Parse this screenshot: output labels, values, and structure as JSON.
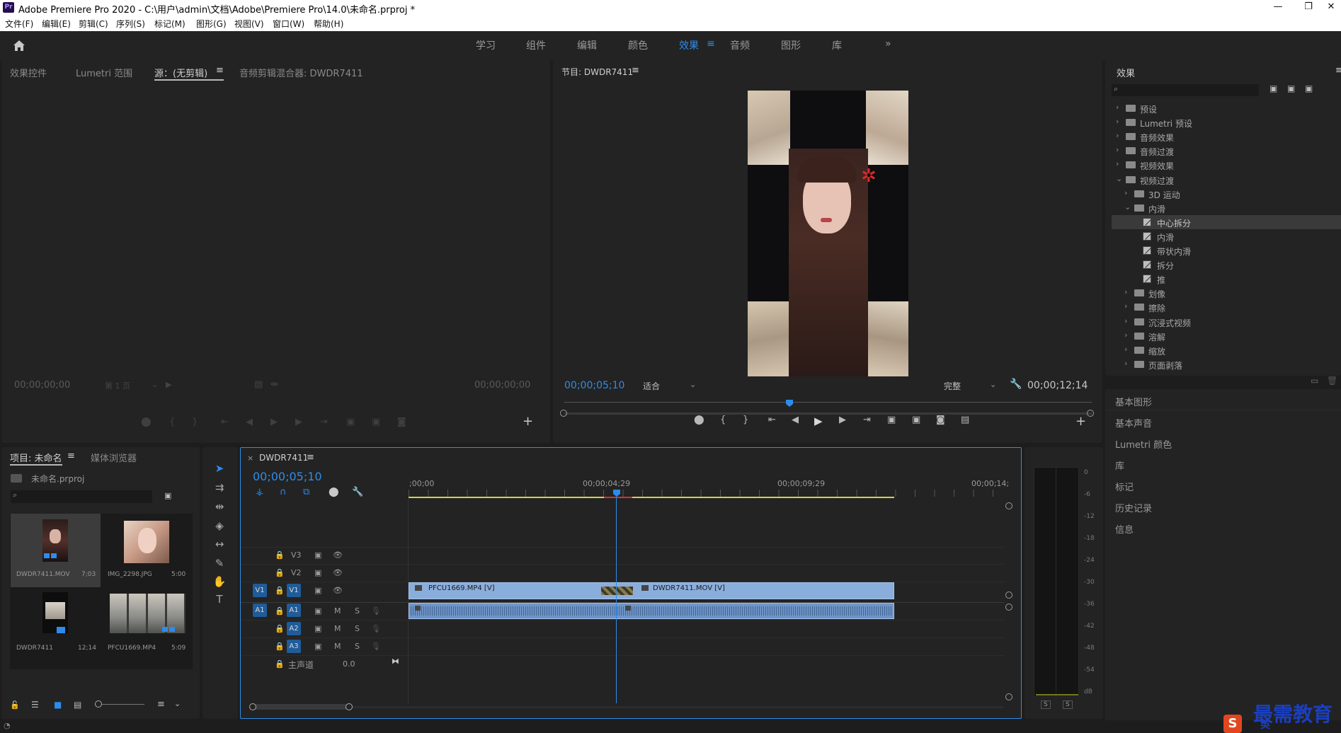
{
  "titlebar": {
    "app_icon": "Pr",
    "title": "Adobe Premiere Pro 2020 - C:\\用户\\admin\\文档\\Adobe\\Premiere Pro\\14.0\\未命名.prproj *",
    "minimize": "—",
    "maximize": "❐",
    "close": "✕"
  },
  "menu": [
    "文件(F)",
    "编辑(E)",
    "剪辑(C)",
    "序列(S)",
    "标记(M)",
    "图形(G)",
    "视图(V)",
    "窗口(W)",
    "帮助(H)"
  ],
  "workspaces": {
    "items": [
      "学习",
      "组件",
      "编辑",
      "颜色",
      "效果",
      "音频",
      "图形",
      "库"
    ],
    "active": "效果",
    "more": "»"
  },
  "source_panel": {
    "tabs": [
      "效果控件",
      "Lumetri 范围",
      "源：(无剪辑)",
      "音频剪辑混合器: DWDR7411"
    ],
    "active_tab": "源：(无剪辑)",
    "timecode_left": "00;00;00;00",
    "page": "第 1 页",
    "timecode_right": "00;00;00;00",
    "add": "+"
  },
  "program_panel": {
    "title": "节目: DWDR7411",
    "timecode": "00;00;05;10",
    "fit": "适合",
    "quality": "完整",
    "duration": "00;00;12;14",
    "add": "+"
  },
  "effects_panel": {
    "title": "效果",
    "tree": [
      {
        "label": "预设",
        "level": 0,
        "type": "folder",
        "expanded": false
      },
      {
        "label": "Lumetri 预设",
        "level": 0,
        "type": "folder",
        "expanded": false
      },
      {
        "label": "音频效果",
        "level": 0,
        "type": "folder",
        "expanded": false
      },
      {
        "label": "音频过渡",
        "level": 0,
        "type": "folder",
        "expanded": false
      },
      {
        "label": "视频效果",
        "level": 0,
        "type": "folder",
        "expanded": false
      },
      {
        "label": "视频过渡",
        "level": 0,
        "type": "folder",
        "expanded": true
      },
      {
        "label": "3D 运动",
        "level": 1,
        "type": "folder",
        "expanded": false
      },
      {
        "label": "内滑",
        "level": 1,
        "type": "folder",
        "expanded": true
      },
      {
        "label": "中心拆分",
        "level": 2,
        "type": "effect",
        "selected": true
      },
      {
        "label": "内滑",
        "level": 2,
        "type": "effect"
      },
      {
        "label": "带状内滑",
        "level": 2,
        "type": "effect"
      },
      {
        "label": "拆分",
        "level": 2,
        "type": "effect"
      },
      {
        "label": "推",
        "level": 2,
        "type": "effect"
      },
      {
        "label": "划像",
        "level": 1,
        "type": "folder",
        "expanded": false
      },
      {
        "label": "擦除",
        "level": 1,
        "type": "folder",
        "expanded": false
      },
      {
        "label": "沉浸式视频",
        "level": 1,
        "type": "folder",
        "expanded": false
      },
      {
        "label": "溶解",
        "level": 1,
        "type": "folder",
        "expanded": false
      },
      {
        "label": "缩放",
        "level": 1,
        "type": "folder",
        "expanded": false
      },
      {
        "label": "页面剥落",
        "level": 1,
        "type": "folder",
        "expanded": false
      }
    ]
  },
  "side_panels": [
    "基本图形",
    "基本声音",
    "Lumetri 颜色",
    "库",
    "标记",
    "历史记录",
    "信息"
  ],
  "project_panel": {
    "tabs": [
      "项目: 未命名",
      "媒体浏览器"
    ],
    "project_file": "未命名.prproj",
    "items": [
      {
        "name": "DWDR7411.MOV",
        "duration": "7;03"
      },
      {
        "name": "IMG_2298.JPG",
        "duration": "5:00"
      },
      {
        "name": "DWDR7411",
        "duration": "12;14"
      },
      {
        "name": "PFCU1669.MP4",
        "duration": "5:09"
      }
    ]
  },
  "timeline": {
    "sequence": "DWDR7411",
    "timecode": "00;00;05;10",
    "ruler": [
      ";00;00",
      "00;00;04;29",
      "00;00;09;29",
      "00;00;14;"
    ],
    "video_tracks": [
      "V3",
      "V2",
      "V1"
    ],
    "audio_tracks": [
      "A1",
      "A2",
      "A3"
    ],
    "master": "主声道",
    "master_value": "0.0",
    "source_v": "V1",
    "source_a": "A1",
    "mute": "M",
    "solo": "S",
    "clips": {
      "v1_a": "PFCU1669.MP4 [V]",
      "v1_b": "DWDR7411.MOV [V]"
    }
  },
  "meter": {
    "labels": [
      "0",
      "-6",
      "-12",
      "-18",
      "-24",
      "-30",
      "-36",
      "-42",
      "-48",
      "-54",
      "dB"
    ],
    "solo": "S"
  },
  "watermark": {
    "text": "最需教育",
    "ime": "英"
  }
}
